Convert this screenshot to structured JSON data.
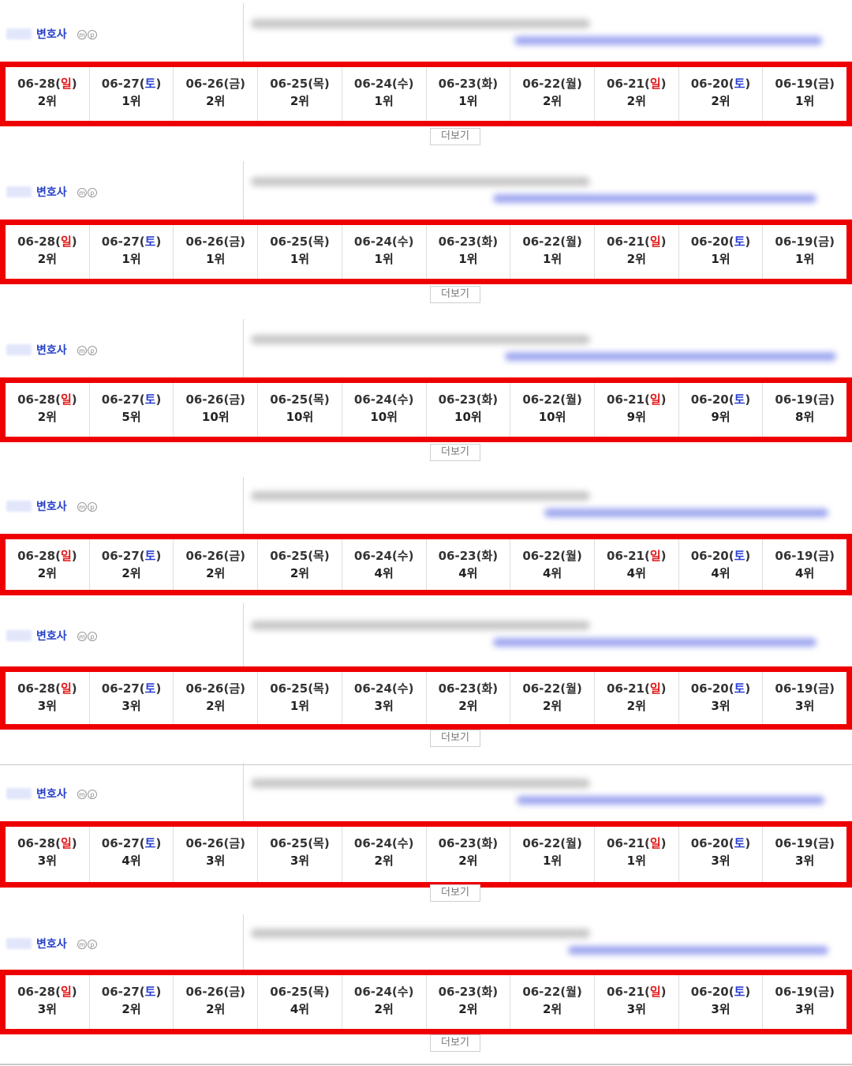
{
  "keyword_label": "변호사",
  "badge_m": "m",
  "badge_p": "p",
  "more_label": "더보기",
  "blocks": [
    {
      "dates": [
        "06-28",
        "06-27",
        "06-26",
        "06-25",
        "06-24",
        "06-23",
        "06-22",
        "06-21",
        "06-20",
        "06-19"
      ],
      "days": [
        "일",
        "토",
        "금",
        "목",
        "수",
        "화",
        "월",
        "일",
        "토",
        "금"
      ],
      "ranks": [
        "2위",
        "1위",
        "2위",
        "2위",
        "1위",
        "1위",
        "2위",
        "2위",
        "2위",
        "1위"
      ]
    },
    {
      "dates": [
        "06-28",
        "06-27",
        "06-26",
        "06-25",
        "06-24",
        "06-23",
        "06-22",
        "06-21",
        "06-20",
        "06-19"
      ],
      "days": [
        "일",
        "토",
        "금",
        "목",
        "수",
        "화",
        "월",
        "일",
        "토",
        "금"
      ],
      "ranks": [
        "2위",
        "1위",
        "1위",
        "1위",
        "1위",
        "1위",
        "1위",
        "2위",
        "1위",
        "1위"
      ]
    },
    {
      "dates": [
        "06-28",
        "06-27",
        "06-26",
        "06-25",
        "06-24",
        "06-23",
        "06-22",
        "06-21",
        "06-20",
        "06-19"
      ],
      "days": [
        "일",
        "토",
        "금",
        "목",
        "수",
        "화",
        "월",
        "일",
        "토",
        "금"
      ],
      "ranks": [
        "2위",
        "5위",
        "10위",
        "10위",
        "10위",
        "10위",
        "10위",
        "9위",
        "9위",
        "8위"
      ]
    },
    {
      "dates": [
        "06-28",
        "06-27",
        "06-26",
        "06-25",
        "06-24",
        "06-23",
        "06-22",
        "06-21",
        "06-20",
        "06-19"
      ],
      "days": [
        "일",
        "토",
        "금",
        "목",
        "수",
        "화",
        "월",
        "일",
        "토",
        "금"
      ],
      "ranks": [
        "2위",
        "2위",
        "2위",
        "2위",
        "4위",
        "4위",
        "4위",
        "4위",
        "4위",
        "4위"
      ]
    },
    {
      "dates": [
        "06-28",
        "06-27",
        "06-26",
        "06-25",
        "06-24",
        "06-23",
        "06-22",
        "06-21",
        "06-20",
        "06-19"
      ],
      "days": [
        "일",
        "토",
        "금",
        "목",
        "수",
        "화",
        "월",
        "일",
        "토",
        "금"
      ],
      "ranks": [
        "3위",
        "3위",
        "2위",
        "1위",
        "3위",
        "2위",
        "2위",
        "2위",
        "3위",
        "3위"
      ]
    },
    {
      "dates": [
        "06-28",
        "06-27",
        "06-26",
        "06-25",
        "06-24",
        "06-23",
        "06-22",
        "06-21",
        "06-20",
        "06-19"
      ],
      "days": [
        "일",
        "토",
        "금",
        "목",
        "수",
        "화",
        "월",
        "일",
        "토",
        "금"
      ],
      "ranks": [
        "3위",
        "4위",
        "3위",
        "3위",
        "2위",
        "2위",
        "1위",
        "1위",
        "3위",
        "3위"
      ]
    },
    {
      "dates": [
        "06-28",
        "06-27",
        "06-26",
        "06-25",
        "06-24",
        "06-23",
        "06-22",
        "06-21",
        "06-20",
        "06-19"
      ],
      "days": [
        "일",
        "토",
        "금",
        "목",
        "수",
        "화",
        "월",
        "일",
        "토",
        "금"
      ],
      "ranks": [
        "3위",
        "2위",
        "2위",
        "4위",
        "2위",
        "2위",
        "2위",
        "3위",
        "3위",
        "3위"
      ]
    }
  ],
  "colors": {
    "highlight": "#ee0000",
    "sunday": "#e01818",
    "saturday": "#2a3fd0",
    "keyword": "#2540c8"
  }
}
